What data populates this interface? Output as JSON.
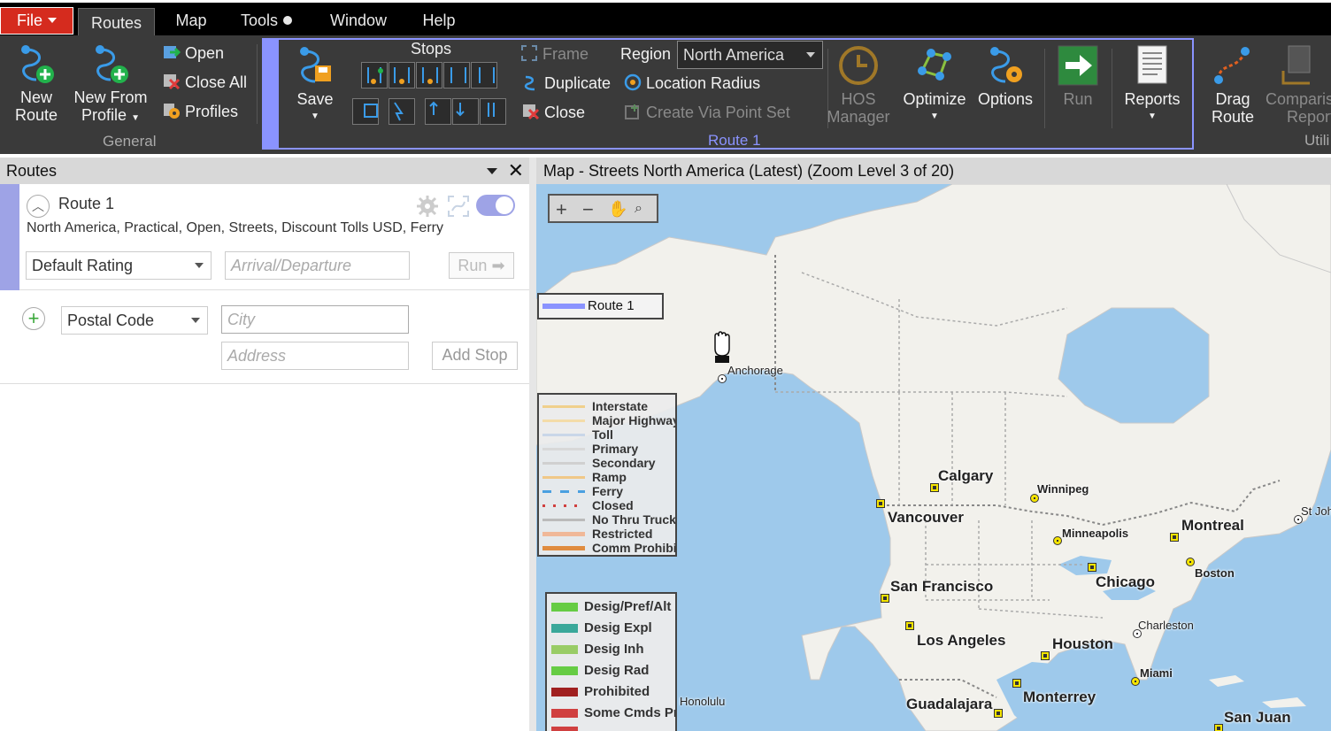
{
  "menu": {
    "file": "File",
    "routes": "Routes",
    "map": "Map",
    "tools": "Tools",
    "window": "Window",
    "help": "Help"
  },
  "ribbon": {
    "general": {
      "new_route": [
        "New",
        "Route"
      ],
      "new_from_profile": [
        "New From",
        "Profile"
      ],
      "open": "Open",
      "close_all": "Close All",
      "profiles": "Profiles",
      "label": "General"
    },
    "route1": {
      "save": "Save",
      "stops_label": "Stops",
      "frame": "Frame",
      "duplicate": "Duplicate",
      "close": "Close",
      "region_label": "Region",
      "region_value": "North America",
      "location_radius": "Location Radius",
      "create_via_point_set": "Create Via Point Set",
      "hos_manager": [
        "HOS",
        "Manager"
      ],
      "optimize": "Optimize",
      "options": "Options",
      "run": "Run",
      "reports": "Reports",
      "label": "Route 1"
    },
    "utilities": {
      "drag_route": [
        "Drag",
        "Route"
      ],
      "comparison_report": [
        "Comparis",
        "Report"
      ],
      "label": "Utili"
    }
  },
  "routes_panel": {
    "title": "Routes",
    "route": {
      "name": "Route 1",
      "description": "North America, Practical, Open, Streets, Discount Tolls USD, Ferry",
      "rating": "Default Rating",
      "arrival_placeholder": "Arrival/Departure",
      "run": "Run"
    },
    "new_stop": {
      "type": "Postal Code",
      "city_placeholder": "City",
      "address_placeholder": "Address",
      "add_stop": "Add Stop"
    }
  },
  "map": {
    "title": "Map - Streets North America (Latest) (Zoom Level 3 of 20)",
    "route_legend": "Route 1",
    "road_legend": [
      {
        "label": "Interstate",
        "color": "#f0d08c"
      },
      {
        "label": "Major Highway",
        "color": "#f4dca8"
      },
      {
        "label": "Toll",
        "color": "#c9d6e8"
      },
      {
        "label": "Primary",
        "color": "#d8d8d8"
      },
      {
        "label": "Secondary",
        "color": "#d0d0d0"
      },
      {
        "label": "Ramp",
        "color": "#f0c888"
      },
      {
        "label": "Ferry",
        "color": "#4aa0e0"
      },
      {
        "label": "Closed",
        "color": "#d04040"
      },
      {
        "label": "No Thru Truck",
        "color": "#bbbbbb"
      },
      {
        "label": "Restricted",
        "color": "#f0b898"
      },
      {
        "label": "Comm Prohibi",
        "color": "#e08c40"
      }
    ],
    "truck_legend": [
      {
        "label": "Desig/Pref/Alt",
        "color": "#66cc44"
      },
      {
        "label": "Desig Expl",
        "color": "#3aa89a"
      },
      {
        "label": "Desig Inh",
        "color": "#99cc66"
      },
      {
        "label": "Desig Rad",
        "color": "#66cc44"
      },
      {
        "label": "Prohibited",
        "color": "#a02020"
      },
      {
        "label": "Some Cmds Pr",
        "color": "#d04040"
      }
    ],
    "cities": {
      "anchorage": "Anchorage",
      "calgary": "Calgary",
      "vancouver": "Vancouver",
      "winnipeg": "Winnipeg",
      "minneapolis": "Minneapolis",
      "montreal": "Montreal",
      "boston": "Boston",
      "st_john": "St John",
      "san_francisco": "San Francisco",
      "chicago": "Chicago",
      "charleston": "Charleston",
      "los_angeles": "Los Angeles",
      "houston": "Houston",
      "miami": "Miami",
      "monterrey": "Monterrey",
      "guadalajara": "Guadalajara",
      "honolulu": "Honolulu",
      "san_juan": "San Juan"
    }
  },
  "colors": {
    "accent": "#8a93ff",
    "file_red": "#d52b1e",
    "ribbon_bg": "#3a3a3a",
    "water": "#9ec9eb",
    "land": "#f2f1ec"
  }
}
